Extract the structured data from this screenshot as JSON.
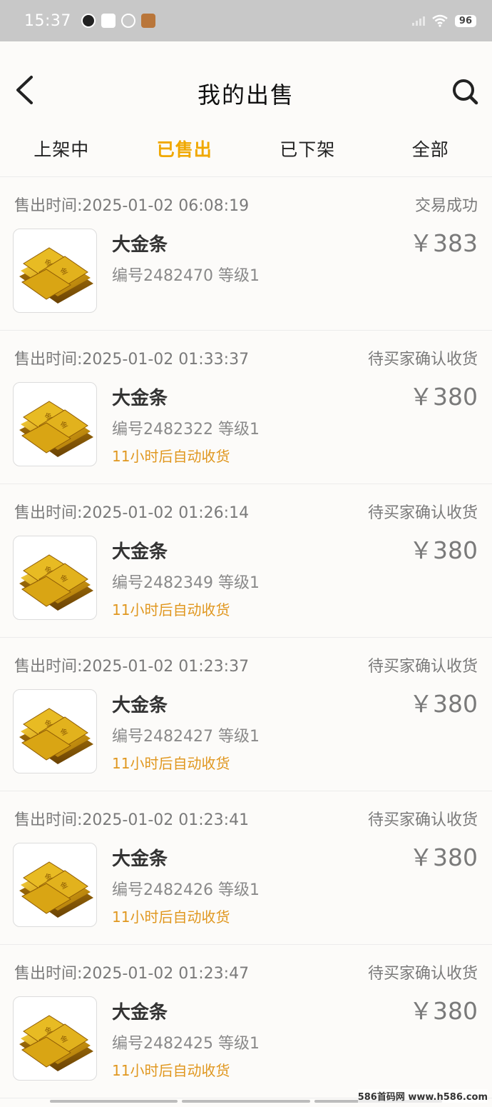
{
  "status_bar": {
    "time": "15:37",
    "battery": "96",
    "icons": [
      "qq-icon",
      "mail-icon",
      "leaf-icon",
      "grid-icon",
      "signal-icon",
      "wifi-icon",
      "battery-icon"
    ]
  },
  "header": {
    "title": "我的出售",
    "back_icon": "chevron-left-icon",
    "search_icon": "search-icon"
  },
  "tabs": [
    {
      "label": "上架中",
      "active": false
    },
    {
      "label": "已售出",
      "active": true
    },
    {
      "label": "已下架",
      "active": false
    },
    {
      "label": "全部",
      "active": false
    }
  ],
  "colors": {
    "accent": "#f0a800",
    "note": "#e0971f",
    "muted": "#7a7a7a"
  },
  "orders": [
    {
      "time": "售出时间:2025-01-02 06:08:19",
      "status": "交易成功",
      "name": "大金条",
      "meta": "编号2482470 等级1",
      "note": "",
      "price": "￥383"
    },
    {
      "time": "售出时间:2025-01-02 01:33:37",
      "status": "待买家确认收货",
      "name": "大金条",
      "meta": "编号2482322 等级1",
      "note": "11小时后自动收货",
      "price": "￥380"
    },
    {
      "time": "售出时间:2025-01-02 01:26:14",
      "status": "待买家确认收货",
      "name": "大金条",
      "meta": "编号2482349 等级1",
      "note": "11小时后自动收货",
      "price": "￥380"
    },
    {
      "time": "售出时间:2025-01-02 01:23:37",
      "status": "待买家确认收货",
      "name": "大金条",
      "meta": "编号2482427 等级1",
      "note": "11小时后自动收货",
      "price": "￥380"
    },
    {
      "time": "售出时间:2025-01-02 01:23:41",
      "status": "待买家确认收货",
      "name": "大金条",
      "meta": "编号2482426 等级1",
      "note": "11小时后自动收货",
      "price": "￥380"
    },
    {
      "time": "售出时间:2025-01-02 01:23:47",
      "status": "待买家确认收货",
      "name": "大金条",
      "meta": "编号2482425 等级1",
      "note": "11小时后自动收货",
      "price": "￥380"
    }
  ],
  "watermark": "586首码网 www.h586.com"
}
